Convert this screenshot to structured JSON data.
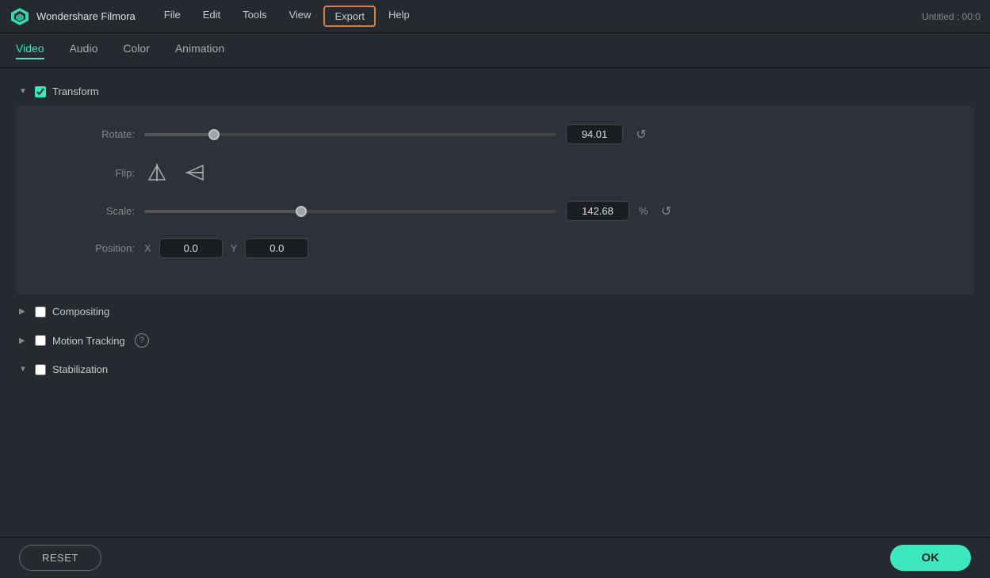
{
  "app": {
    "logo_text": "Wondershare Filmora",
    "window_title": "Untitled : 00:0"
  },
  "menu": {
    "items": [
      "File",
      "Edit",
      "Tools",
      "View",
      "Export",
      "Help"
    ],
    "export_label": "Export"
  },
  "tabs": [
    {
      "label": "Video",
      "active": true
    },
    {
      "label": "Audio",
      "active": false
    },
    {
      "label": "Color",
      "active": false
    },
    {
      "label": "Animation",
      "active": false
    }
  ],
  "transform": {
    "section_title": "Transform",
    "rotate_label": "Rotate:",
    "rotate_value": "94.01",
    "rotate_thumb_pct": 17,
    "flip_label": "Flip:",
    "scale_label": "Scale:",
    "scale_value": "142.68",
    "scale_unit": "%",
    "scale_thumb_pct": 38,
    "position_label": "Position:",
    "position_x_label": "X",
    "position_x_value": "0.0",
    "position_y_label": "Y",
    "position_y_value": "0.0"
  },
  "compositing": {
    "section_title": "Compositing"
  },
  "motion_tracking": {
    "section_title": "Motion Tracking"
  },
  "stabilization": {
    "section_title": "Stabilization"
  },
  "buttons": {
    "reset_label": "RESET",
    "ok_label": "OK"
  },
  "icons": {
    "flip_horizontal": "⬦",
    "flip_vertical": "⬦",
    "reset": "↺"
  }
}
